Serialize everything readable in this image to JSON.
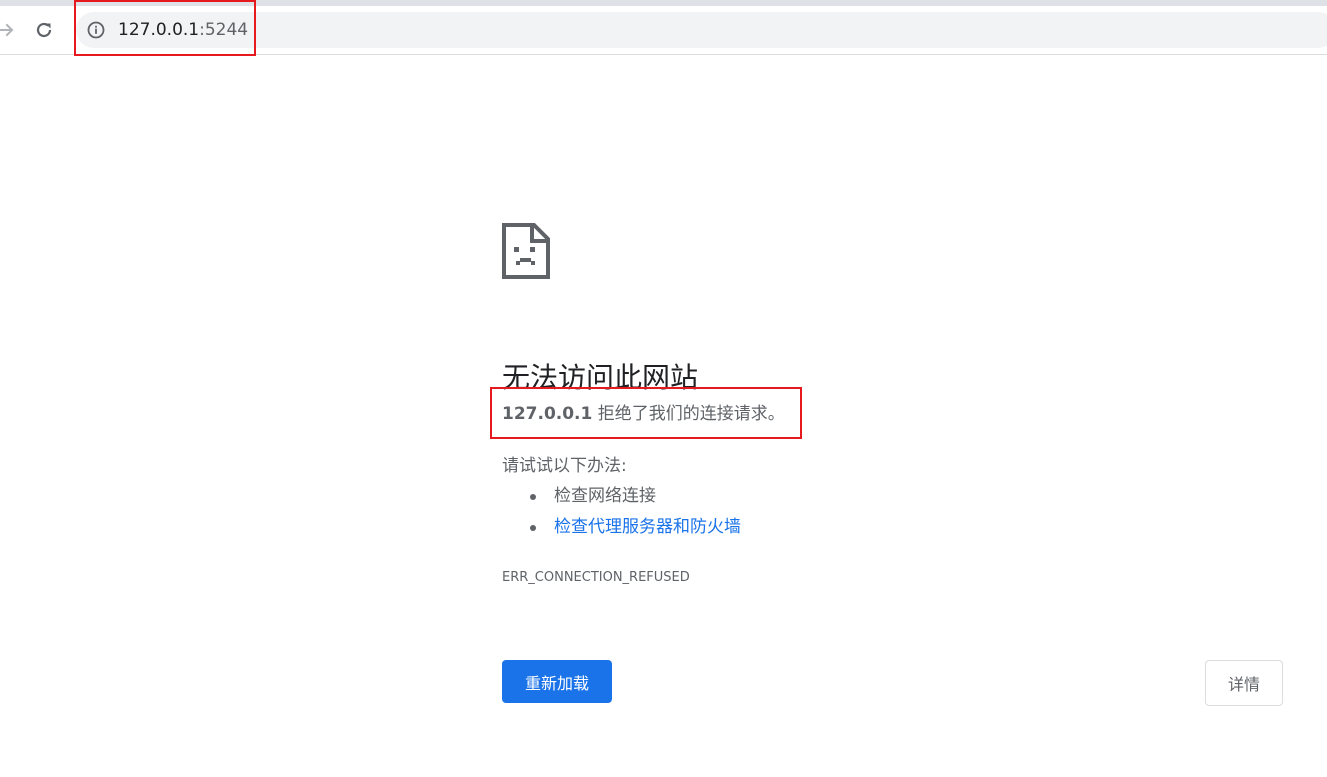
{
  "toolbar": {
    "url_host": "127.0.0.1",
    "url_port": ":5244",
    "icons": [
      "forward-icon",
      "reload-icon",
      "info-icon"
    ]
  },
  "error_page": {
    "title": "无法访问此网站",
    "host": "127.0.0.1",
    "message": " 拒绝了我们的连接请求。",
    "try_heading": "请试试以下办法:",
    "suggestions": [
      {
        "label": "检查网络连接",
        "is_link": false
      },
      {
        "label": "检查代理服务器和防火墙",
        "is_link": true
      }
    ],
    "error_code": "ERR_CONNECTION_REFUSED",
    "reload_label": "重新加载",
    "details_label": "详情"
  },
  "colors": {
    "accent": "#1a73e8",
    "highlight_box": "#e6191f",
    "muted_text": "#5f6368"
  }
}
